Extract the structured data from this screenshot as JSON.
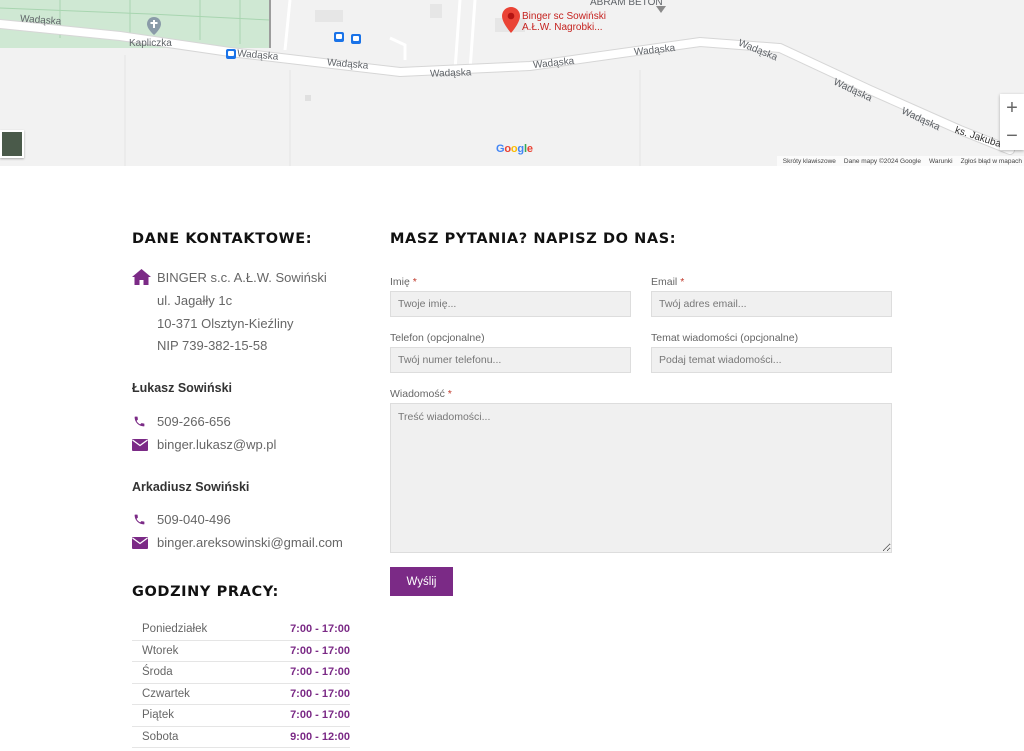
{
  "map": {
    "streets": [
      "Wadąska",
      "Wadąska",
      "Wadąska",
      "Wadąska",
      "Wadąska",
      "Wadąska",
      "Wadąska",
      "Wadąska",
      "Wadąska"
    ],
    "chapel": "Kapliczka",
    "poi_name_line1": "Binger sc Sowiński",
    "poi_name_line2": "A.Ł.W. Nagrobki...",
    "abram": "ABRAM BETON",
    "road_jakuba": "ks. Jakuba",
    "google": [
      "G",
      "o",
      "o",
      "g",
      "l",
      "e"
    ],
    "google_colors": [
      "#4285f4",
      "#ea4335",
      "#fbbc05",
      "#4285f4",
      "#34a853",
      "#ea4335"
    ],
    "footer": [
      "Skróty klawiszowe",
      "Dane mapy ©2024 Google",
      "Warunki",
      "Zgłoś błąd w mapach"
    ],
    "zoom_in": "+",
    "zoom_out": "−"
  },
  "contact": {
    "heading": "DANE KONTAKTOWE:",
    "company": "BINGER s.c. A.Ł.W. Sowiński",
    "street": "ul. Jagałły 1c",
    "city": "10-371 Olsztyn-Kieźliny",
    "nip": "NIP 739-382-15-58",
    "persons": [
      {
        "name": "Łukasz Sowiński",
        "phone": "509-266-656",
        "email": "binger.lukasz@wp.pl"
      },
      {
        "name": "Arkadiusz Sowiński",
        "phone": "509-040-496",
        "email": "binger.areksowinski@gmail.com"
      }
    ]
  },
  "hours": {
    "heading": "GODZINY PRACY:",
    "rows": [
      {
        "day": "Poniedziałek",
        "time": "7:00 - 17:00"
      },
      {
        "day": "Wtorek",
        "time": "7:00 - 17:00"
      },
      {
        "day": "Środa",
        "time": "7:00 - 17:00"
      },
      {
        "day": "Czwartek",
        "time": "7:00 - 17:00"
      },
      {
        "day": "Piątek",
        "time": "7:00 - 17:00"
      },
      {
        "day": "Sobota",
        "time": "9:00 - 12:00"
      }
    ]
  },
  "form": {
    "heading": "MASZ PYTANIA? NAPISZ DO NAS:",
    "name_label": "Imię",
    "name_placeholder": "Twoje imię...",
    "email_label": "Email",
    "email_placeholder": "Twój adres email...",
    "phone_label": "Telefon (opcjonalne)",
    "phone_placeholder": "Twój numer telefonu...",
    "subject_label": "Temat wiadomości (opcjonalne)",
    "subject_placeholder": "Podaj temat wiadomości...",
    "message_label": "Wiadomość",
    "message_placeholder": "Treść wiadomości...",
    "required_mark": "*",
    "submit": "Wyślij"
  },
  "colors": {
    "accent": "#7b2a86",
    "map_pin": "#ea4335"
  },
  "icons": [
    "home-icon",
    "phone-icon",
    "envelope-icon",
    "map-pin-icon",
    "chapel-icon",
    "bus-stop-icon"
  ]
}
